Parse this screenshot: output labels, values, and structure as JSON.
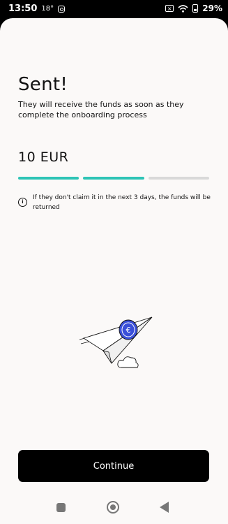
{
  "status_bar": {
    "time": "13:50",
    "temperature": "18°",
    "battery_percent": "29%"
  },
  "confirmation": {
    "title": "Sent!",
    "subtitle": "They will receive the funds as soon as they complete the onboarding process",
    "amount": "10 EUR",
    "progress_steps": [
      {
        "completed": true
      },
      {
        "completed": true
      },
      {
        "completed": false
      }
    ],
    "notice": "If they don't claim it in the next 3 days, the funds will be returned"
  },
  "actions": {
    "continue_label": "Continue"
  },
  "colors": {
    "accent": "#2ec4b6",
    "progress_inactive": "#d9d9d9",
    "coin": "#3a4fd8",
    "button": "#000000"
  },
  "icons": {
    "info": "info-icon",
    "illustration": "paper-plane-coin-illustration",
    "nav_recent": "square-icon",
    "nav_home": "circle-icon",
    "nav_back": "back-triangle-icon"
  }
}
